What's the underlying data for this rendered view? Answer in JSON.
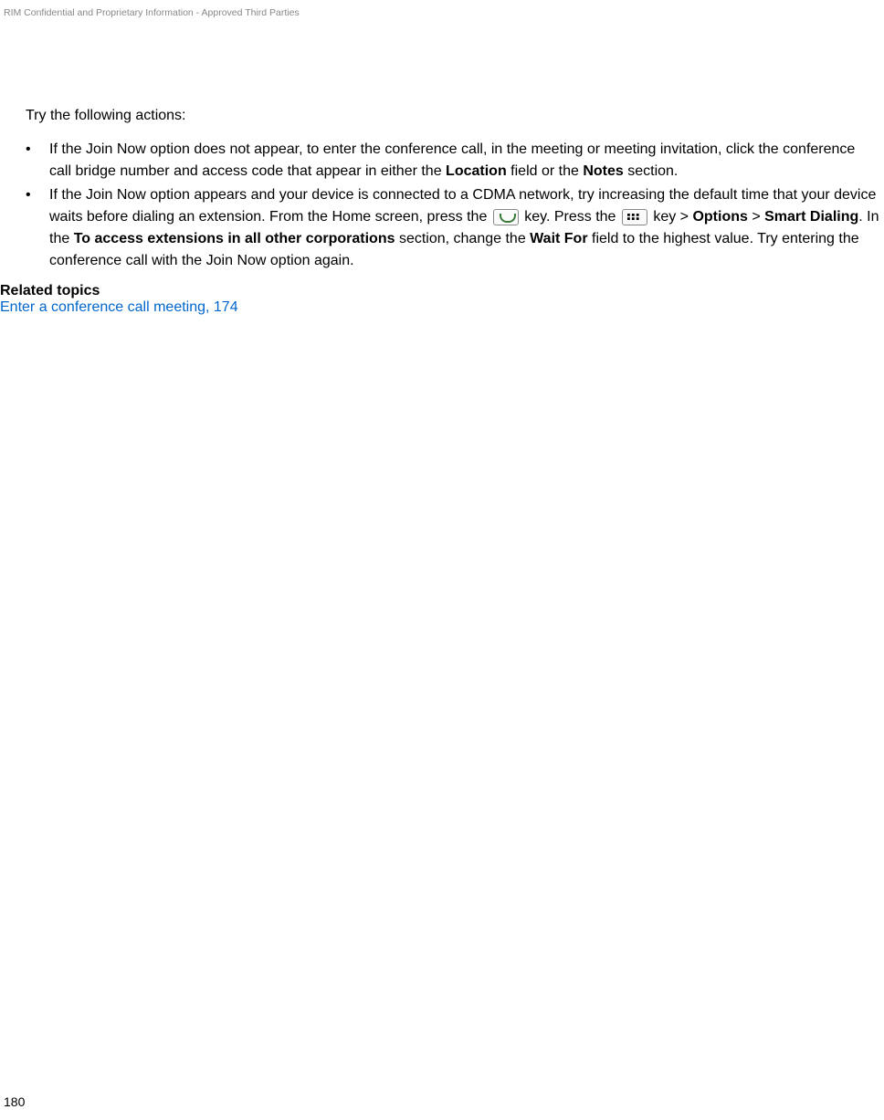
{
  "header": {
    "confidential": "RIM Confidential and Proprietary Information - Approved Third Parties"
  },
  "content": {
    "intro": "Try the following actions:",
    "bullets": [
      {
        "marker": "•",
        "segments": [
          {
            "text": "If the Join Now option does not appear, to enter the conference call, in the meeting or meeting invitation, click the conference call bridge number and access code that appear in either the ",
            "bold": false
          },
          {
            "text": "Location",
            "bold": true
          },
          {
            "text": " field or the ",
            "bold": false
          },
          {
            "text": "Notes",
            "bold": true
          },
          {
            "text": " section.",
            "bold": false
          }
        ]
      },
      {
        "marker": "•",
        "segments": [
          {
            "text": "If the Join Now option appears and your device is connected to a CDMA network, try increasing the default time that your device waits before dialing an extension. From the Home screen, press the ",
            "bold": false
          },
          {
            "icon": "send-key"
          },
          {
            "text": " key. Press the ",
            "bold": false
          },
          {
            "icon": "menu-key"
          },
          {
            "text": " key > ",
            "bold": false
          },
          {
            "text": "Options",
            "bold": true
          },
          {
            "text": " > ",
            "bold": false
          },
          {
            "text": "Smart Dialing",
            "bold": true
          },
          {
            "text": ". In the ",
            "bold": false
          },
          {
            "text": "To access extensions in all other corporations",
            "bold": true
          },
          {
            "text": " section, change the ",
            "bold": false
          },
          {
            "text": "Wait For",
            "bold": true
          },
          {
            "text": " field to the highest value. Try entering the conference call with the Join Now option again.",
            "bold": false
          }
        ]
      }
    ]
  },
  "related": {
    "heading": "Related topics",
    "link": "Enter a conference call meeting, 174"
  },
  "footer": {
    "page": "180"
  }
}
